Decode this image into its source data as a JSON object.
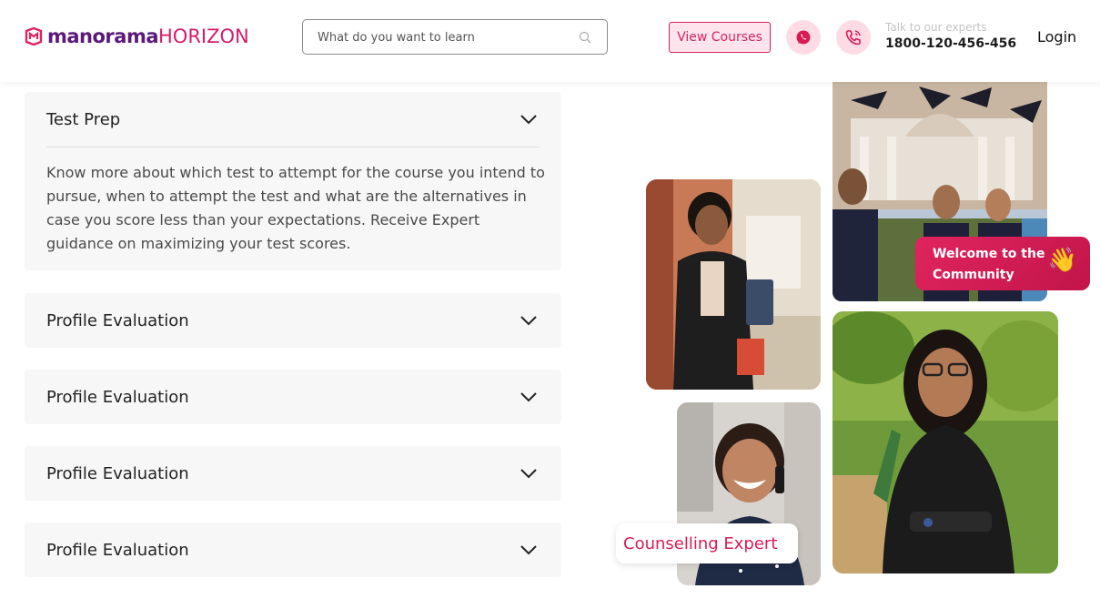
{
  "header": {
    "logo": {
      "part1": "manorama",
      "part2": "HORIZON"
    },
    "search": {
      "placeholder": "What do you want to learn"
    },
    "view_courses_label": "View Courses",
    "talk_label": "Talk to our experts",
    "phone": "1800-120-456-456",
    "login_label": "Login",
    "icons": [
      "search-icon",
      "whatsapp-icon",
      "phone-icon"
    ]
  },
  "accordion": {
    "items": [
      {
        "title": "Test Prep",
        "expanded": true,
        "body": "Know more about which test to attempt for the course you intend to pursue, when to attempt the test and what are the alternatives in case you score less than your expectations. Receive Expert guidance on maximizing your test scores."
      },
      {
        "title": "Profile Evaluation",
        "expanded": false
      },
      {
        "title": "Profile Evaluation",
        "expanded": false
      },
      {
        "title": "Profile Evaluation",
        "expanded": false
      },
      {
        "title": "Profile Evaluation",
        "expanded": false
      }
    ]
  },
  "gallery": {
    "welcome_badge": "Welcome to the Community",
    "counselling_badge": "Counselling Expert"
  },
  "colors": {
    "brand_purple": "#5b1a7a",
    "brand_pink": "#d81b6a",
    "accent": "#d0265f",
    "accordion_bg": "#f7f7f7"
  }
}
